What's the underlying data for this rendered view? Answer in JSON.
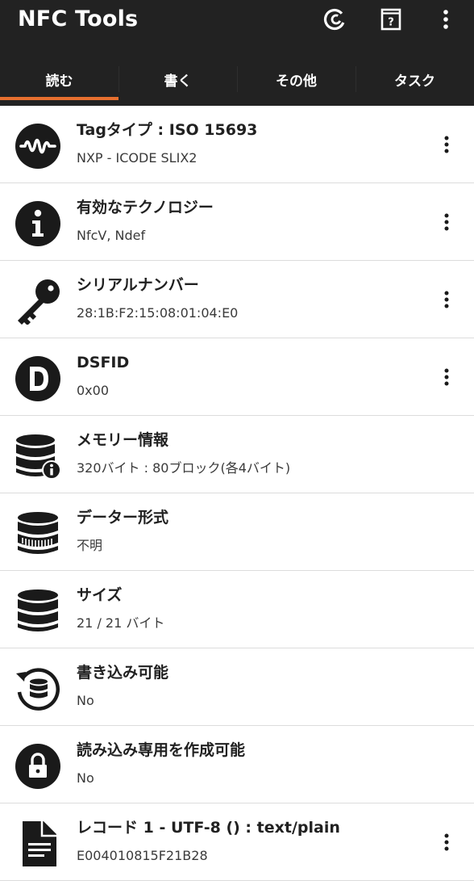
{
  "app": {
    "title": "NFC Tools"
  },
  "toolbar": {
    "icons": [
      "coin-icon",
      "help-icon",
      "overflow-menu-icon"
    ]
  },
  "tabs": [
    {
      "label": "読む",
      "active": true
    },
    {
      "label": "書く",
      "active": false
    },
    {
      "label": "その他",
      "active": false
    },
    {
      "label": "タスク",
      "active": false
    }
  ],
  "colors": {
    "appbar": "#222222",
    "accent": "#e7702f",
    "icon": "#1a1a1a"
  },
  "rows": [
    {
      "title": "Tagタイプ : ISO 15693",
      "subtitle": "NXP - ICODE SLIX2",
      "icon": "tag-wave-icon",
      "menu": true
    },
    {
      "title": "有効なテクノロジー",
      "subtitle": "NfcV, Ndef",
      "icon": "info-icon",
      "menu": true
    },
    {
      "title": "シリアルナンバー",
      "subtitle": "28:1B:F2:15:08:01:04:E0",
      "icon": "key-icon",
      "menu": true
    },
    {
      "title": "DSFID",
      "subtitle": "0x00",
      "icon": "letter-d-icon",
      "menu": true
    },
    {
      "title": "メモリー情報",
      "subtitle": "320バイト : 80ブロック(各4バイト)",
      "icon": "database-info-icon",
      "menu": false
    },
    {
      "title": "データー形式",
      "subtitle": "不明",
      "icon": "database-format-icon",
      "menu": false
    },
    {
      "title": "サイズ",
      "subtitle": "21 / 21 バイト",
      "icon": "database-icon",
      "menu": false
    },
    {
      "title": "書き込み可能",
      "subtitle": "No",
      "icon": "database-sync-icon",
      "menu": false
    },
    {
      "title": "読み込み専用を作成可能",
      "subtitle": "No",
      "icon": "lock-icon",
      "menu": false
    },
    {
      "title": "レコード 1 - UTF-8 () : text/plain",
      "subtitle": "E004010815F21B28",
      "icon": "document-icon",
      "menu": true
    }
  ]
}
